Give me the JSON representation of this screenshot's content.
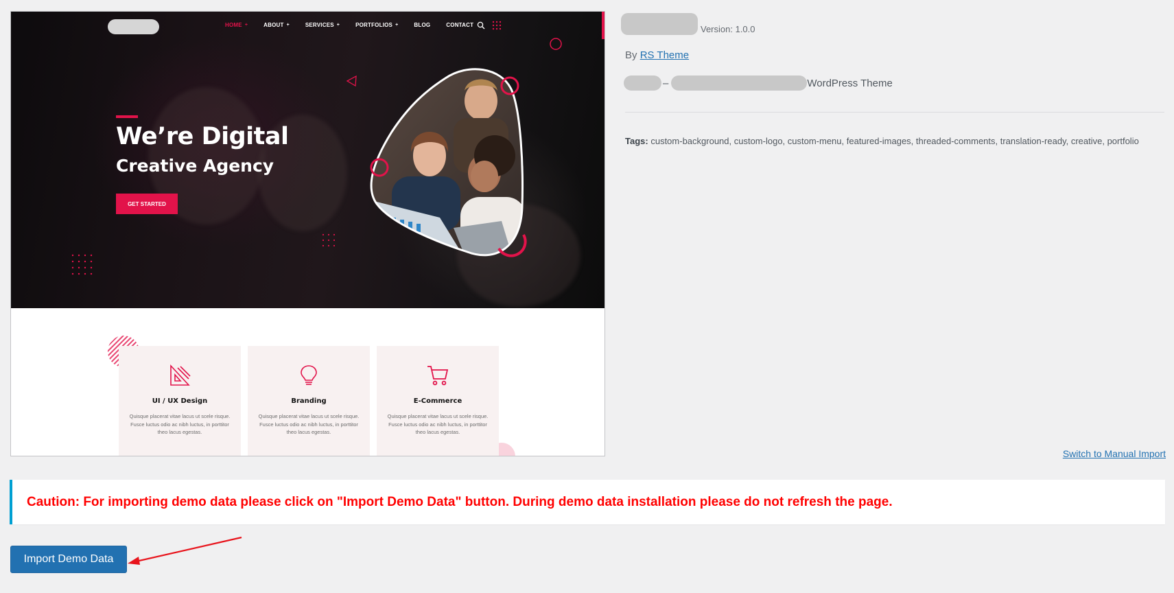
{
  "preview": {
    "nav": [
      {
        "label": "HOME",
        "plus": "+"
      },
      {
        "label": "ABOUT",
        "plus": "+"
      },
      {
        "label": "SERVICES",
        "plus": "+"
      },
      {
        "label": "PORTFOLIOS",
        "plus": "+"
      },
      {
        "label": "BLOG",
        "plus": ""
      },
      {
        "label": "CONTACT",
        "plus": ""
      }
    ],
    "hero_title_1": "We’re Digital",
    "hero_title_2": "Creative Agency",
    "cta_label": "GET STARTED",
    "cards": [
      {
        "icon": "design-tools-icon",
        "title": "UI / UX Design",
        "text": "Quisque placerat vitae lacus ut scele risque. Fusce luctus odio ac nibh luctus, in porttitor theo lacus egestas."
      },
      {
        "icon": "lightbulb-icon",
        "title": "Branding",
        "text": "Quisque placerat vitae lacus ut scele risque. Fusce luctus odio ac nibh luctus, in porttitor theo lacus egestas."
      },
      {
        "icon": "shopping-cart-icon",
        "title": "E-Commerce",
        "text": "Quisque placerat vitae lacus ut scele risque. Fusce luctus odio ac nibh luctus, in porttitor theo lacus egestas."
      }
    ]
  },
  "theme": {
    "version": "Version: 1.0.0",
    "by": "By",
    "author": "RS Theme",
    "desc_separator": "–",
    "desc_suffix": "WordPress Theme",
    "tags_label": "Tags:",
    "tags": "custom-background, custom-logo, custom-menu, featured-images, threaded-comments, translation-ready, creative, portfolio"
  },
  "switch_manual": "Switch to Manual Import",
  "caution": "Caution: For importing demo data please click on \"Import Demo Data\" button. During demo data installation please do not refresh the page.",
  "import_button": "Import Demo Data",
  "colors": {
    "accent": "#e2134a",
    "button": "#2271b1",
    "caution_text": "#ff0000",
    "notice_border": "#00a0d2"
  }
}
